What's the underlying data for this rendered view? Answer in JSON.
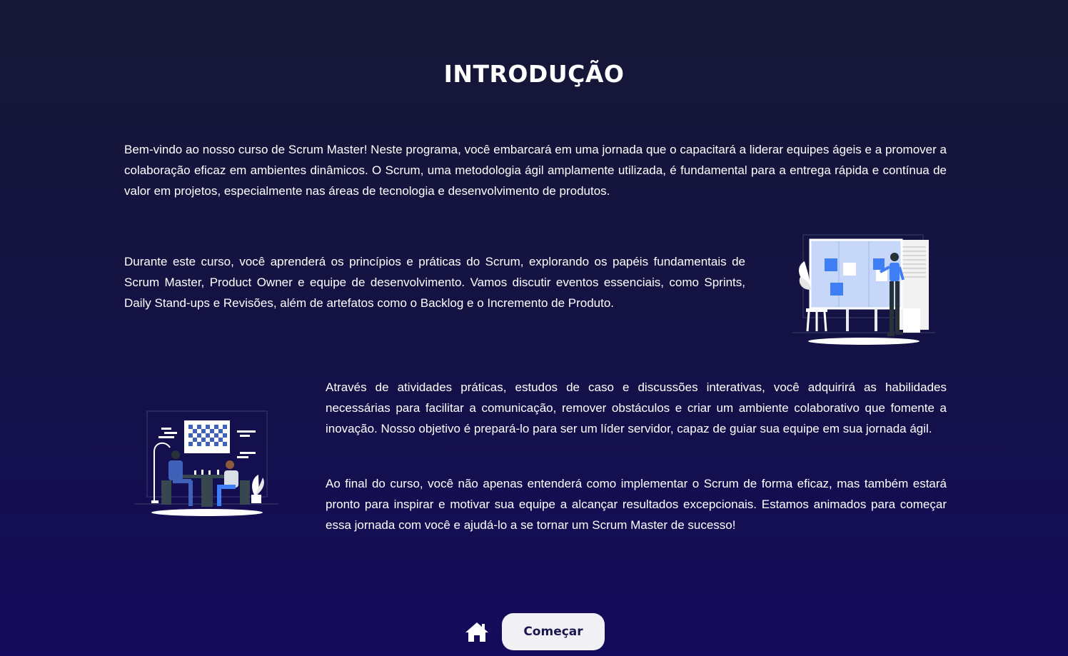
{
  "page": {
    "title": "INTRODUÇÃO"
  },
  "content": {
    "paragraphs": [
      "Bem-vindo ao nosso curso de Scrum Master! Neste programa, você embarcará em uma jornada que o capacitará a liderar equipes ágeis e a promover a colaboração eficaz em ambientes dinâmicos. O Scrum, uma metodologia ágil amplamente utilizada, é fundamental para a entrega rápida e contínua de valor em projetos, especialmente nas áreas de tecnologia e desenvolvimento de produtos.",
      "Durante este curso, você aprenderá os princípios e práticas do Scrum, explorando os papéis fundamentais de Scrum Master, Product Owner e equipe de desenvolvimento. Vamos discutir eventos essenciais, como Sprints, Daily Stand-ups e Revisões, além de artefatos como o Backlog e o Incremento de Produto.",
      "Através de atividades práticas, estudos de caso e discussões interativas, você adquirirá as habilidades necessárias para facilitar a comunicação, remover obstáculos e criar um ambiente colaborativo que fomente a inovação. Nosso objetivo é prepará-lo para ser um líder servidor, capaz de guiar sua equipe em sua jornada ágil.",
      "Ao final do curso, você não apenas entenderá como implementar o Scrum de forma eficaz, mas também estará pronto para inspirar e motivar sua equipe a alcançar resultados excepcionais. Estamos animados para começar essa jornada com você e ajudá-lo a se tornar um Scrum Master de sucesso!"
    ]
  },
  "illustrations": {
    "board": "kanban-board-illustration",
    "chess": "chess-game-illustration"
  },
  "footer": {
    "home_icon": "home-icon",
    "start_label": "Começar"
  },
  "colors": {
    "background_top": "#161735",
    "background_bottom": "#140b5c",
    "accent_blue": "#3f7ef5",
    "button_bg": "#f1f0f5",
    "button_text": "#1b1550"
  }
}
